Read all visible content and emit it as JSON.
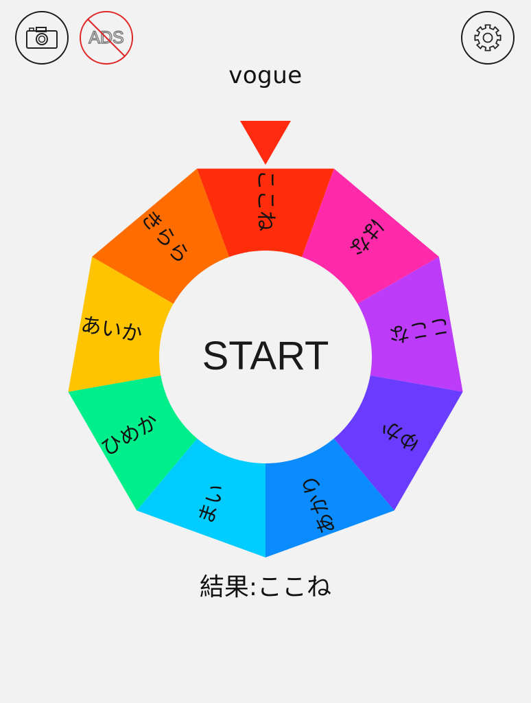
{
  "toolbar": {
    "camera_icon": "camera-icon",
    "ads_label": "ADS",
    "settings_icon": "gear-icon"
  },
  "roulette": {
    "title": "vogue",
    "start_label": "START",
    "pointer_color": "#ff2a0f",
    "segments": [
      {
        "label": "ここね",
        "color": "#ff2d0a"
      },
      {
        "label": "はな",
        "color": "#ff2aaa"
      },
      {
        "label": "ここな",
        "color": "#bd3cfa"
      },
      {
        "label": "ゆか",
        "color": "#6a3cff"
      },
      {
        "label": "あかり",
        "color": "#0a8cff"
      },
      {
        "label": "まい",
        "color": "#00ccff"
      },
      {
        "label": "ひめか",
        "color": "#00ef8a"
      },
      {
        "label": "あいか",
        "color": "#ffc400"
      },
      {
        "label": "きらら",
        "color": "#ff6d00"
      }
    ],
    "result_label": "結果:ここね"
  }
}
